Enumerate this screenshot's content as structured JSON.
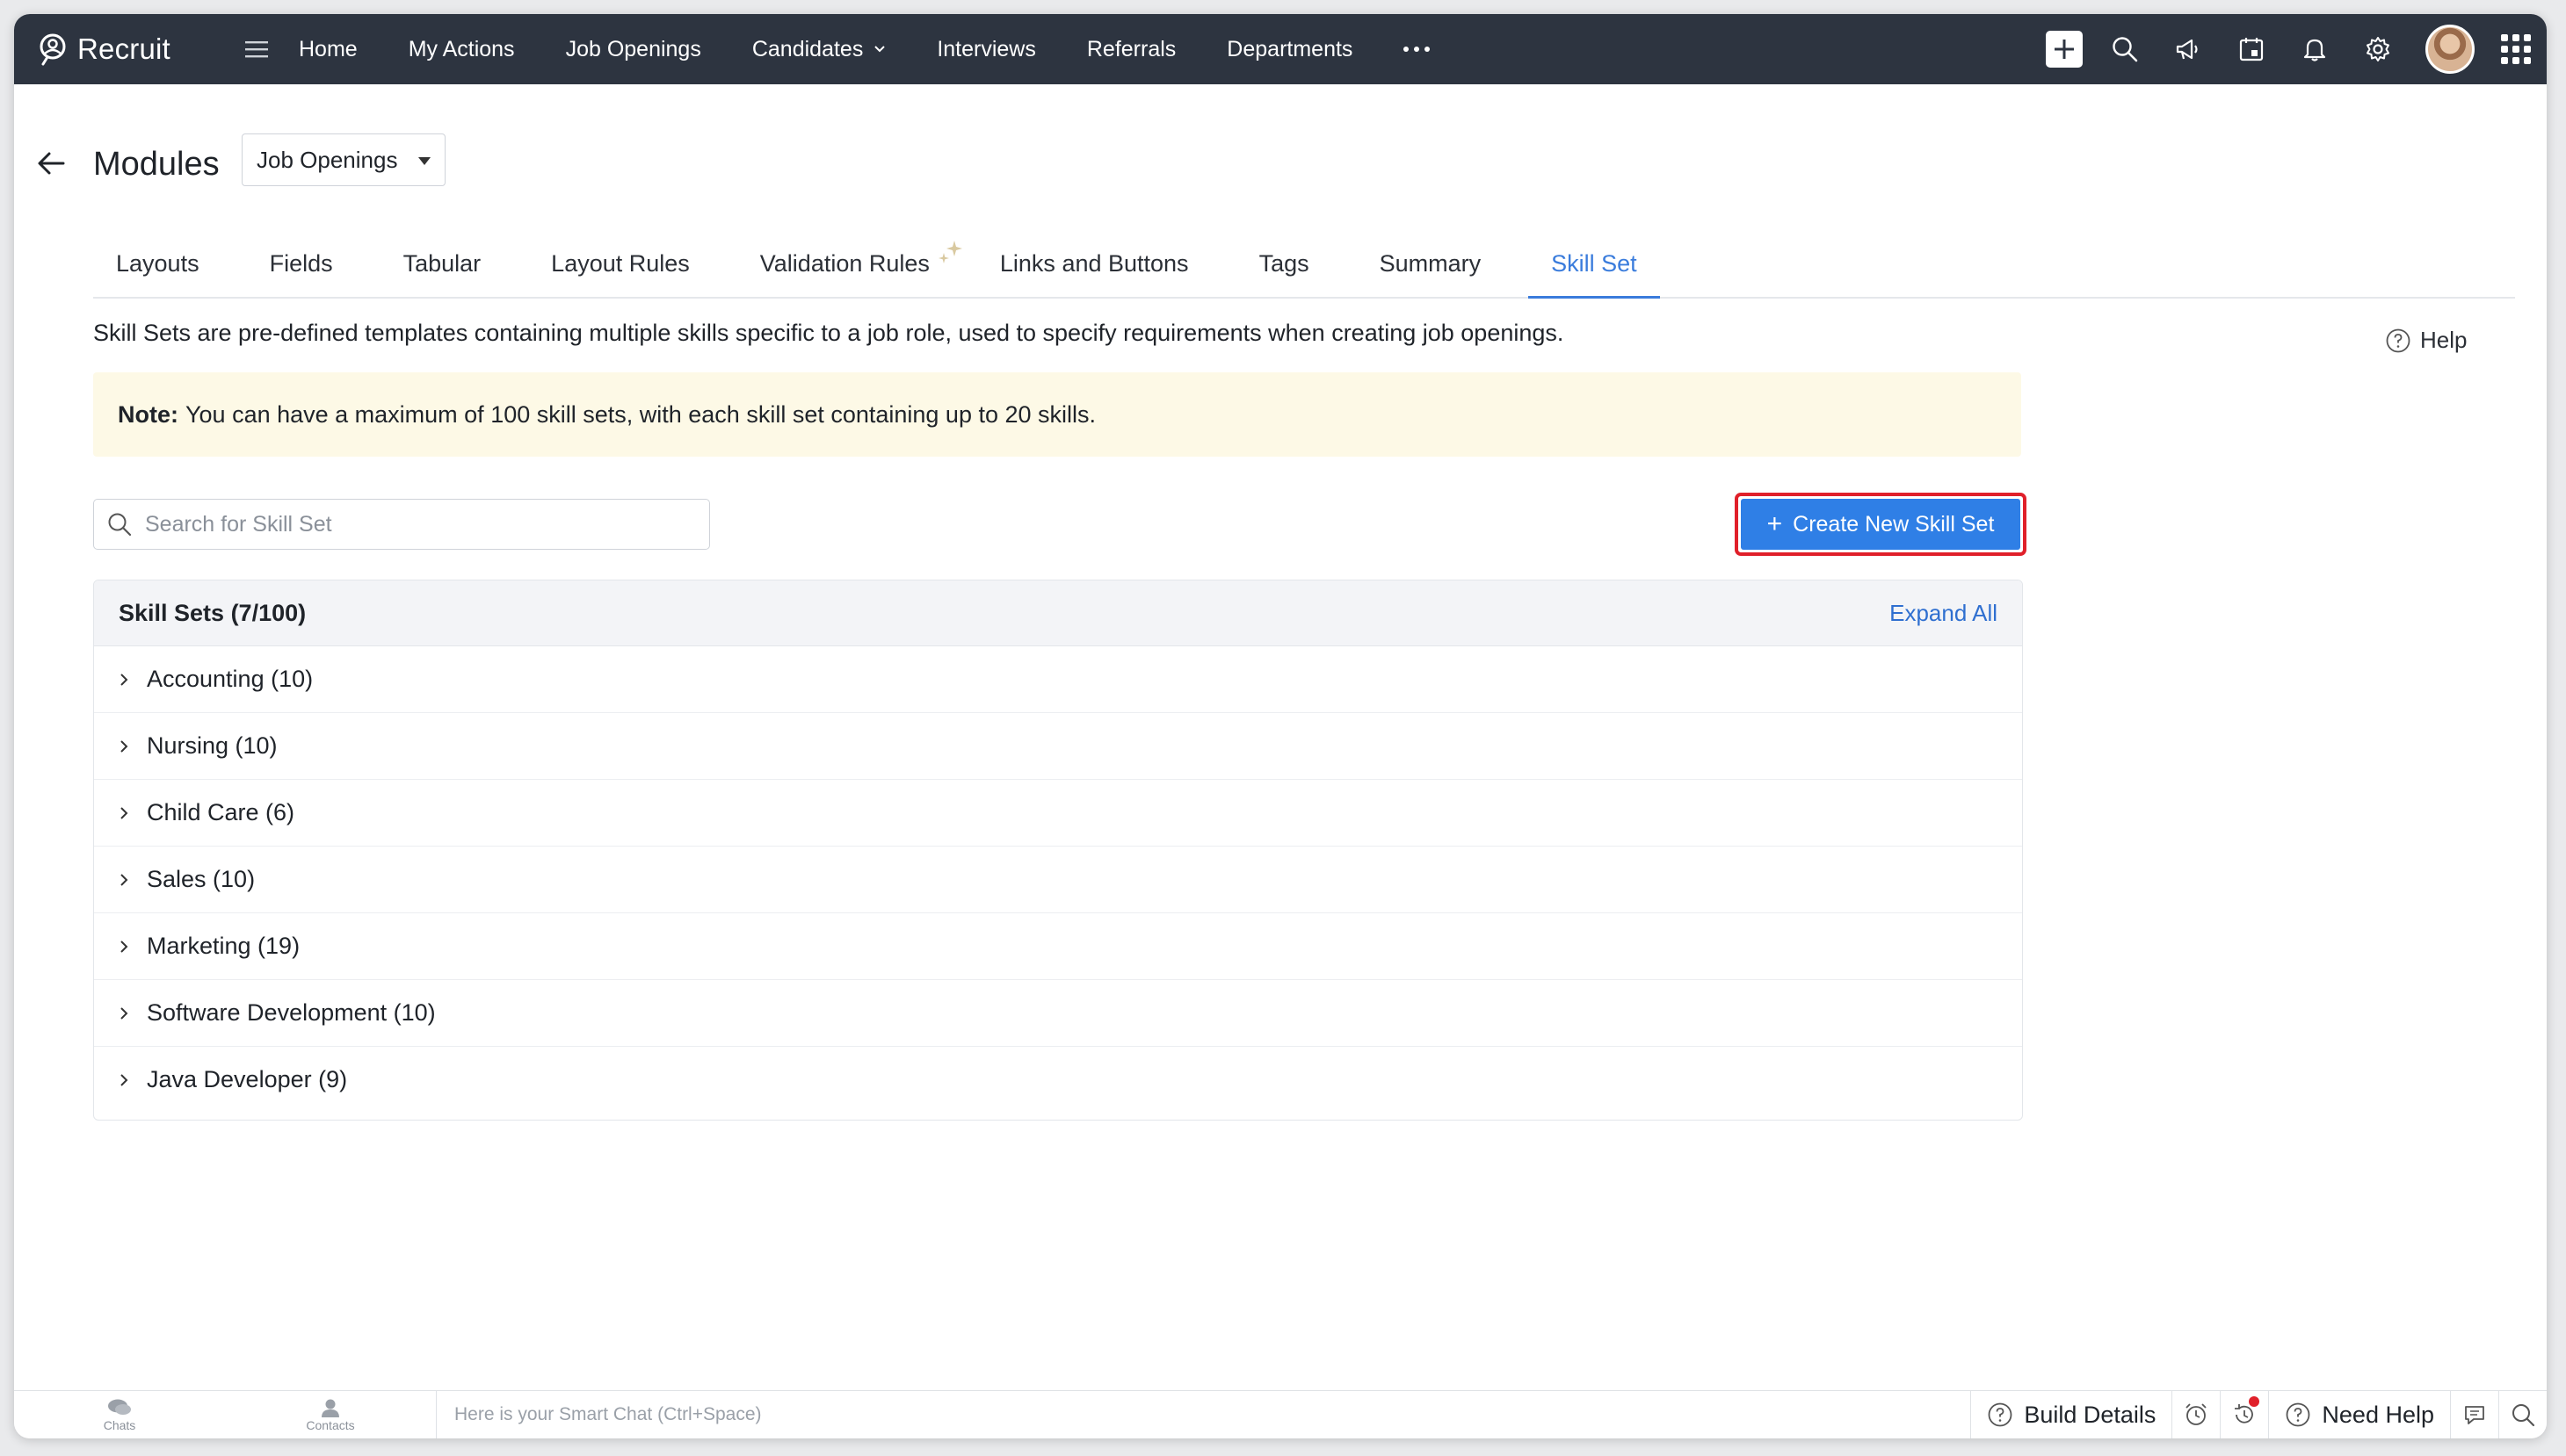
{
  "app": {
    "name": "Recruit"
  },
  "nav": {
    "items": [
      {
        "label": "Home"
      },
      {
        "label": "My Actions"
      },
      {
        "label": "Job Openings"
      },
      {
        "label": "Candidates",
        "has_dropdown": true
      },
      {
        "label": "Interviews"
      },
      {
        "label": "Referrals"
      },
      {
        "label": "Departments"
      }
    ],
    "icons": [
      "plus-icon",
      "search-icon",
      "announcement-icon",
      "calendar-icon",
      "bell-icon",
      "gear-icon",
      "avatar",
      "apps-grid-icon"
    ]
  },
  "header": {
    "title": "Modules",
    "module_select": "Job Openings"
  },
  "tabs": [
    {
      "label": "Layouts"
    },
    {
      "label": "Fields"
    },
    {
      "label": "Tabular"
    },
    {
      "label": "Layout Rules"
    },
    {
      "label": "Validation Rules",
      "badge_icon": "sparkle-icon"
    },
    {
      "label": "Links and Buttons"
    },
    {
      "label": "Tags"
    },
    {
      "label": "Summary"
    },
    {
      "label": "Skill Set",
      "active": true
    }
  ],
  "description": "Skill Sets are pre-defined templates containing multiple skills specific to a job role, used to specify requirements when creating job openings.",
  "help_label": "Help",
  "note": {
    "prefix": "Note:",
    "text": "You can have a maximum of 100 skill sets, with each skill set containing up to 20 skills."
  },
  "search": {
    "placeholder": "Search for Skill Set",
    "value": ""
  },
  "create_button": {
    "label": "Create New Skill Set"
  },
  "skill_sets": {
    "header": "Skill Sets (7/100)",
    "expand_all": "Expand All",
    "items": [
      {
        "label": "Accounting (10)"
      },
      {
        "label": "Nursing (10)"
      },
      {
        "label": "Child Care (6)"
      },
      {
        "label": "Sales (10)"
      },
      {
        "label": "Marketing (19)"
      },
      {
        "label": "Software Development (10)"
      },
      {
        "label": "Java Developer (9)"
      }
    ]
  },
  "bottom_bar": {
    "chats": "Chats",
    "contacts": "Contacts",
    "smart_chat_placeholder": "Here is your Smart Chat (Ctrl+Space)",
    "build_details": "Build Details",
    "need_help": "Need Help"
  },
  "colors": {
    "nav_bg": "#2d3440",
    "accent": "#2f7fe6",
    "highlight_border": "#e0202a",
    "note_bg": "#fdf9e6"
  }
}
